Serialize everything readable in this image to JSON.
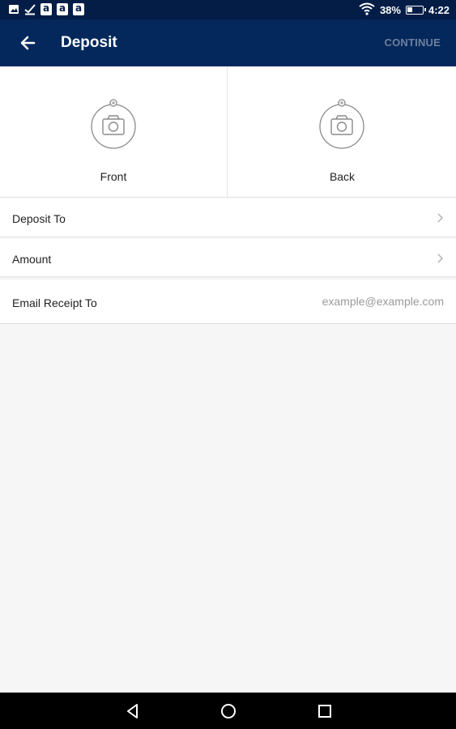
{
  "status_bar": {
    "battery_percent": "38%",
    "time": "4:22",
    "notification_icons": [
      "image-icon",
      "check-icon",
      "amazon-icon",
      "amazon-icon",
      "amazon-icon"
    ]
  },
  "app_bar": {
    "title": "Deposit",
    "continue_label": "CONTINUE"
  },
  "capture": {
    "front_label": "Front",
    "back_label": "Back"
  },
  "form": {
    "deposit_to_label": "Deposit To",
    "amount_label": "Amount",
    "email_label": "Email Receipt To",
    "email_value": "",
    "email_placeholder": "example@example.com"
  },
  "colors": {
    "status_bar": "#041d46",
    "app_bar": "#04285c",
    "continue_disabled": "#6f7f9e",
    "background": "#f6f6f6"
  }
}
